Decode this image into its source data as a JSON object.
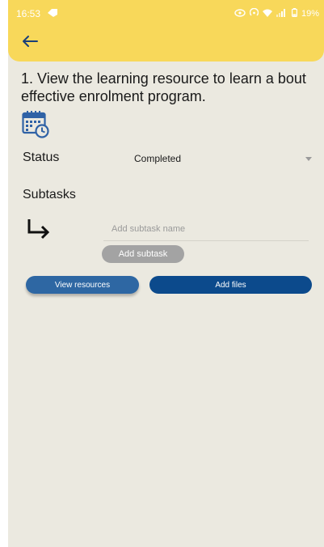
{
  "status_bar": {
    "time": "16:53",
    "battery": "19%"
  },
  "header": {
    "back_icon": "arrow-left-icon"
  },
  "task": {
    "title": "1. View the learning resource to learn a bout effective enrolment program.",
    "icon": "calendar-clock-icon"
  },
  "status": {
    "label": "Status",
    "value": "Completed"
  },
  "subtasks": {
    "label": "Subtasks",
    "input_placeholder": "Add subtask name",
    "add_button_label": "Add subtask"
  },
  "actions": {
    "view_resources_label": "View resources",
    "add_files_label": "Add files"
  },
  "colors": {
    "app_bar": "#f8d85a",
    "background": "#ebe9e0",
    "primary_button": "#0c4a8c",
    "secondary_button": "#2e67a3",
    "icon_blue": "#2f62a6"
  }
}
